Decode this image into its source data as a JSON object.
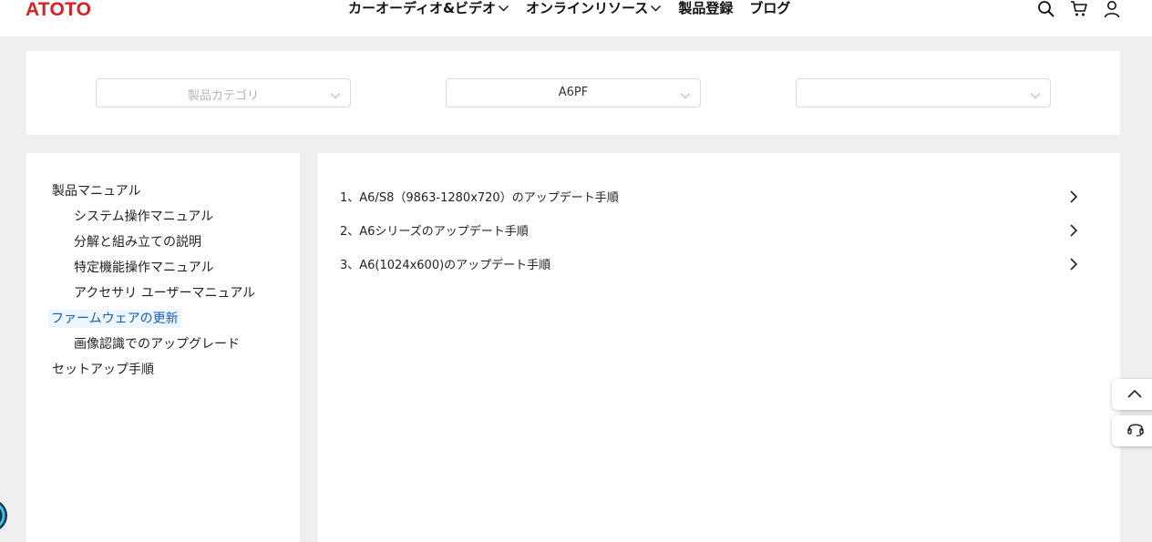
{
  "header": {
    "logo": "ATOTO",
    "nav": [
      {
        "label": "カーオーディオ&ビデオ",
        "has_dropdown": true
      },
      {
        "label": "オンラインリソース",
        "has_dropdown": true
      },
      {
        "label": "製品登録",
        "has_dropdown": false
      },
      {
        "label": "ブログ",
        "has_dropdown": false
      }
    ],
    "icons": [
      "search-icon",
      "cart-icon",
      "user-icon"
    ]
  },
  "filters": {
    "category_placeholder": "製品カテゴリ",
    "model_value": "A6PF",
    "third_value": ""
  },
  "sidebar": {
    "items": [
      {
        "label": "製品マニュアル",
        "level": 0,
        "active": false
      },
      {
        "label": "システム操作マニュアル",
        "level": 1,
        "active": false
      },
      {
        "label": "分解と組み立ての説明",
        "level": 1,
        "active": false
      },
      {
        "label": "特定機能操作マニュアル",
        "level": 1,
        "active": false
      },
      {
        "label": "アクセサリ ユーザーマニュアル",
        "level": 1,
        "active": false
      },
      {
        "label": "ファームウェアの更新",
        "level": 0,
        "active": true
      },
      {
        "label": "画像認識でのアップグレード",
        "level": 1,
        "active": false
      },
      {
        "label": "セットアップ手順",
        "level": 0,
        "active": false
      }
    ]
  },
  "main": {
    "rows": [
      {
        "label": "1、A6/S8（9863-1280x720）のアップデート手順"
      },
      {
        "label": "2、A6シリーズのアップデート手順"
      },
      {
        "label": "3、A6(1024x600)のアップデート手順"
      }
    ]
  },
  "floating": {
    "icons": [
      "chevron-up-icon",
      "headset-icon"
    ]
  },
  "colors": {
    "brand": "#d71f26",
    "page_bg": "#efefef",
    "active_bg": "#edf5ff"
  }
}
